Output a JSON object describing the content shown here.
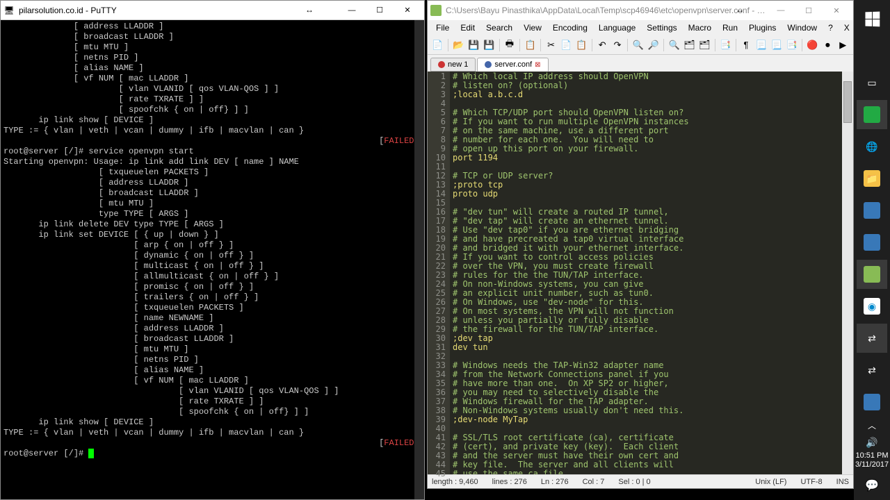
{
  "putty": {
    "title": "pilarsolution.co.id - PuTTY",
    "lines": [
      "              [ address LLADDR ]",
      "              [ broadcast LLADDR ]",
      "              [ mtu MTU ]",
      "              [ netns PID ]",
      "              [ alias NAME ]",
      "              [ vf NUM [ mac LLADDR ]",
      "                       [ vlan VLANID [ qos VLAN-QOS ] ]",
      "                       [ rate TXRATE ] ]",
      "                       [ spoofchk { on | off} ] ]",
      "       ip link show [ DEVICE ]",
      "",
      "TYPE := { vlan | veth | vcan | dummy | ifb | macvlan | can }",
      "                                                                           [FAILED]",
      "root@server [/]# service openvpn start",
      "Starting openvpn: Usage: ip link add link DEV [ name ] NAME",
      "                   [ txqueuelen PACKETS ]",
      "                   [ address LLADDR ]",
      "                   [ broadcast LLADDR ]",
      "                   [ mtu MTU ]",
      "                   type TYPE [ ARGS ]",
      "       ip link delete DEV type TYPE [ ARGS ]",
      "",
      "       ip link set DEVICE [ { up | down } ]",
      "                          [ arp { on | off } ]",
      "                          [ dynamic { on | off } ]",
      "                          [ multicast { on | off } ]",
      "                          [ allmulticast { on | off } ]",
      "                          [ promisc { on | off } ]",
      "                          [ trailers { on | off } ]",
      "                          [ txqueuelen PACKETS ]",
      "                          [ name NEWNAME ]",
      "                          [ address LLADDR ]",
      "                          [ broadcast LLADDR ]",
      "                          [ mtu MTU ]",
      "                          [ netns PID ]",
      "                          [ alias NAME ]",
      "                          [ vf NUM [ mac LLADDR ]",
      "                                   [ vlan VLANID [ qos VLAN-QOS ] ]",
      "                                   [ rate TXRATE ] ]",
      "                                   [ spoofchk { on | off} ] ]",
      "       ip link show [ DEVICE ]",
      "",
      "TYPE := { vlan | veth | vcan | dummy | ifb | macvlan | can }",
      "                                                                           [FAILED]",
      "root@server [/]# "
    ]
  },
  "npp": {
    "title": "C:\\Users\\Bayu Pinasthika\\AppData\\Local\\Temp\\scp46946\\etc\\openvpn\\server.conf - Not...",
    "menu": [
      "File",
      "Edit",
      "Search",
      "View",
      "Encoding",
      "Language",
      "Settings",
      "Macro",
      "Run",
      "Plugins",
      "Window",
      "?"
    ],
    "tabs": [
      {
        "label": "new 1",
        "active": false
      },
      {
        "label": "server.conf",
        "active": true
      }
    ],
    "toolbar_icons": [
      "📄",
      "📂",
      "💾",
      "💾",
      "🖶",
      "📋",
      "✂",
      "📄",
      "📋",
      "↶",
      "↷",
      "🔍",
      "🔎",
      "🔍",
      "🗂",
      "🗂",
      "📑",
      "¶",
      "📃",
      "📃",
      "📑",
      "🔴",
      "⏺",
      "▶"
    ],
    "code": [
      {
        "n": 1,
        "t": "# Which local IP address should OpenVPN",
        "c": true
      },
      {
        "n": 2,
        "t": "# listen on? (optional)",
        "c": true
      },
      {
        "n": 3,
        "t": ";local a.b.c.d",
        "c": false
      },
      {
        "n": 4,
        "t": "",
        "c": false
      },
      {
        "n": 5,
        "t": "# Which TCP/UDP port should OpenVPN listen on?",
        "c": true
      },
      {
        "n": 6,
        "t": "# If you want to run multiple OpenVPN instances",
        "c": true
      },
      {
        "n": 7,
        "t": "# on the same machine, use a different port",
        "c": true
      },
      {
        "n": 8,
        "t": "# number for each one.  You will need to",
        "c": true
      },
      {
        "n": 9,
        "t": "# open up this port on your firewall.",
        "c": true
      },
      {
        "n": 10,
        "t": "port 1194",
        "c": false
      },
      {
        "n": 11,
        "t": "",
        "c": false
      },
      {
        "n": 12,
        "t": "# TCP or UDP server?",
        "c": true
      },
      {
        "n": 13,
        "t": ";proto tcp",
        "c": false
      },
      {
        "n": 14,
        "t": "proto udp",
        "c": false
      },
      {
        "n": 15,
        "t": "",
        "c": false
      },
      {
        "n": 16,
        "t": "# \"dev tun\" will create a routed IP tunnel,",
        "c": true
      },
      {
        "n": 17,
        "t": "# \"dev tap\" will create an ethernet tunnel.",
        "c": true
      },
      {
        "n": 18,
        "t": "# Use \"dev tap0\" if you are ethernet bridging",
        "c": true
      },
      {
        "n": 19,
        "t": "# and have precreated a tap0 virtual interface",
        "c": true
      },
      {
        "n": 20,
        "t": "# and bridged it with your ethernet interface.",
        "c": true
      },
      {
        "n": 21,
        "t": "# If you want to control access policies",
        "c": true
      },
      {
        "n": 22,
        "t": "# over the VPN, you must create firewall",
        "c": true
      },
      {
        "n": 23,
        "t": "# rules for the the TUN/TAP interface.",
        "c": true
      },
      {
        "n": 24,
        "t": "# On non-Windows systems, you can give",
        "c": true
      },
      {
        "n": 25,
        "t": "# an explicit unit number, such as tun0.",
        "c": true
      },
      {
        "n": 26,
        "t": "# On Windows, use \"dev-node\" for this.",
        "c": true
      },
      {
        "n": 27,
        "t": "# On most systems, the VPN will not function",
        "c": true
      },
      {
        "n": 28,
        "t": "# unless you partially or fully disable",
        "c": true
      },
      {
        "n": 29,
        "t": "# the firewall for the TUN/TAP interface.",
        "c": true
      },
      {
        "n": 30,
        "t": ";dev tap",
        "c": false
      },
      {
        "n": 31,
        "t": "dev tun",
        "c": false
      },
      {
        "n": 32,
        "t": "",
        "c": false
      },
      {
        "n": 33,
        "t": "# Windows needs the TAP-Win32 adapter name",
        "c": true
      },
      {
        "n": 34,
        "t": "# from the Network Connections panel if you",
        "c": true
      },
      {
        "n": 35,
        "t": "# have more than one.  On XP SP2 or higher,",
        "c": true
      },
      {
        "n": 36,
        "t": "# you may need to selectively disable the",
        "c": true
      },
      {
        "n": 37,
        "t": "# Windows firewall for the TAP adapter.",
        "c": true
      },
      {
        "n": 38,
        "t": "# Non-Windows systems usually don't need this.",
        "c": true
      },
      {
        "n": 39,
        "t": ";dev-node MyTap",
        "c": false
      },
      {
        "n": 40,
        "t": "",
        "c": false
      },
      {
        "n": 41,
        "t": "# SSL/TLS root certificate (ca), certificate",
        "c": true
      },
      {
        "n": 42,
        "t": "# (cert), and private key (key).  Each client",
        "c": true
      },
      {
        "n": 43,
        "t": "# and the server must have their own cert and",
        "c": true
      },
      {
        "n": 44,
        "t": "# key file.  The server and all clients will",
        "c": true
      },
      {
        "n": 45,
        "t": "# use the same ca file.",
        "c": true
      }
    ],
    "status": {
      "length": "length : 9,460",
      "lines": "lines : 276",
      "ln": "Ln : 276",
      "col": "Col : 7",
      "sel": "Sel : 0 | 0",
      "eol": "Unix (LF)",
      "enc": "UTF-8",
      "ins": "INS"
    }
  },
  "taskbar": {
    "time": "10:51 PM",
    "date": "3/11/2017"
  }
}
